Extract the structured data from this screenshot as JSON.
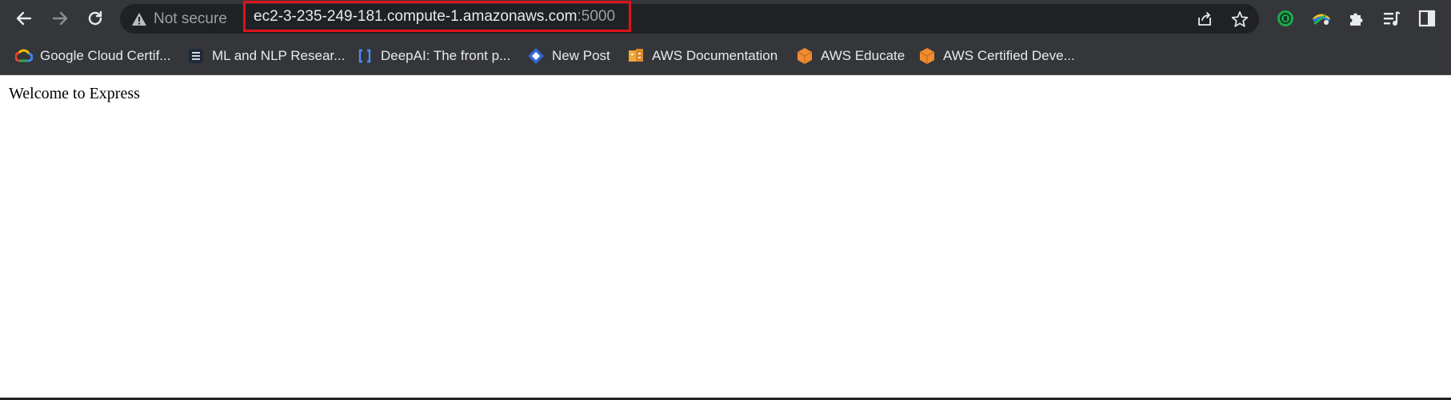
{
  "browser": {
    "security_label": "Not secure",
    "url_host": "ec2-3-235-249-181.compute-1.amazonaws.com",
    "url_port": ":5000",
    "nav_icons": [
      "back-arrow-icon",
      "forward-arrow-icon",
      "reload-icon"
    ],
    "omnibox_icons": [
      "share-icon",
      "star-icon"
    ],
    "extension_icons": [
      "green-extension-icon",
      "eye-dropper-extension-icon",
      "puzzle-extensions-icon",
      "reading-list-icon",
      "side-panel-icon"
    ],
    "colors": {
      "toolbar": "#35363a",
      "omnibox": "#202124",
      "highlight_box": "#e0121a"
    }
  },
  "bookmarks": [
    {
      "label": "Google Cloud Certif...",
      "icon": "google-cloud-icon"
    },
    {
      "label": "ML and NLP Resear...",
      "icon": "doc-list-icon"
    },
    {
      "label": "DeepAI: The front p...",
      "icon": "brackets-icon"
    },
    {
      "label": "New Post",
      "icon": "diamond-icon"
    },
    {
      "label": "AWS Documentation",
      "icon": "aws-box-icon"
    },
    {
      "label": "AWS Educate",
      "icon": "aws-hex-icon"
    },
    {
      "label": "AWS Certified Deve...",
      "icon": "aws-hex-icon"
    }
  ],
  "page": {
    "text": "Welcome to Express"
  }
}
